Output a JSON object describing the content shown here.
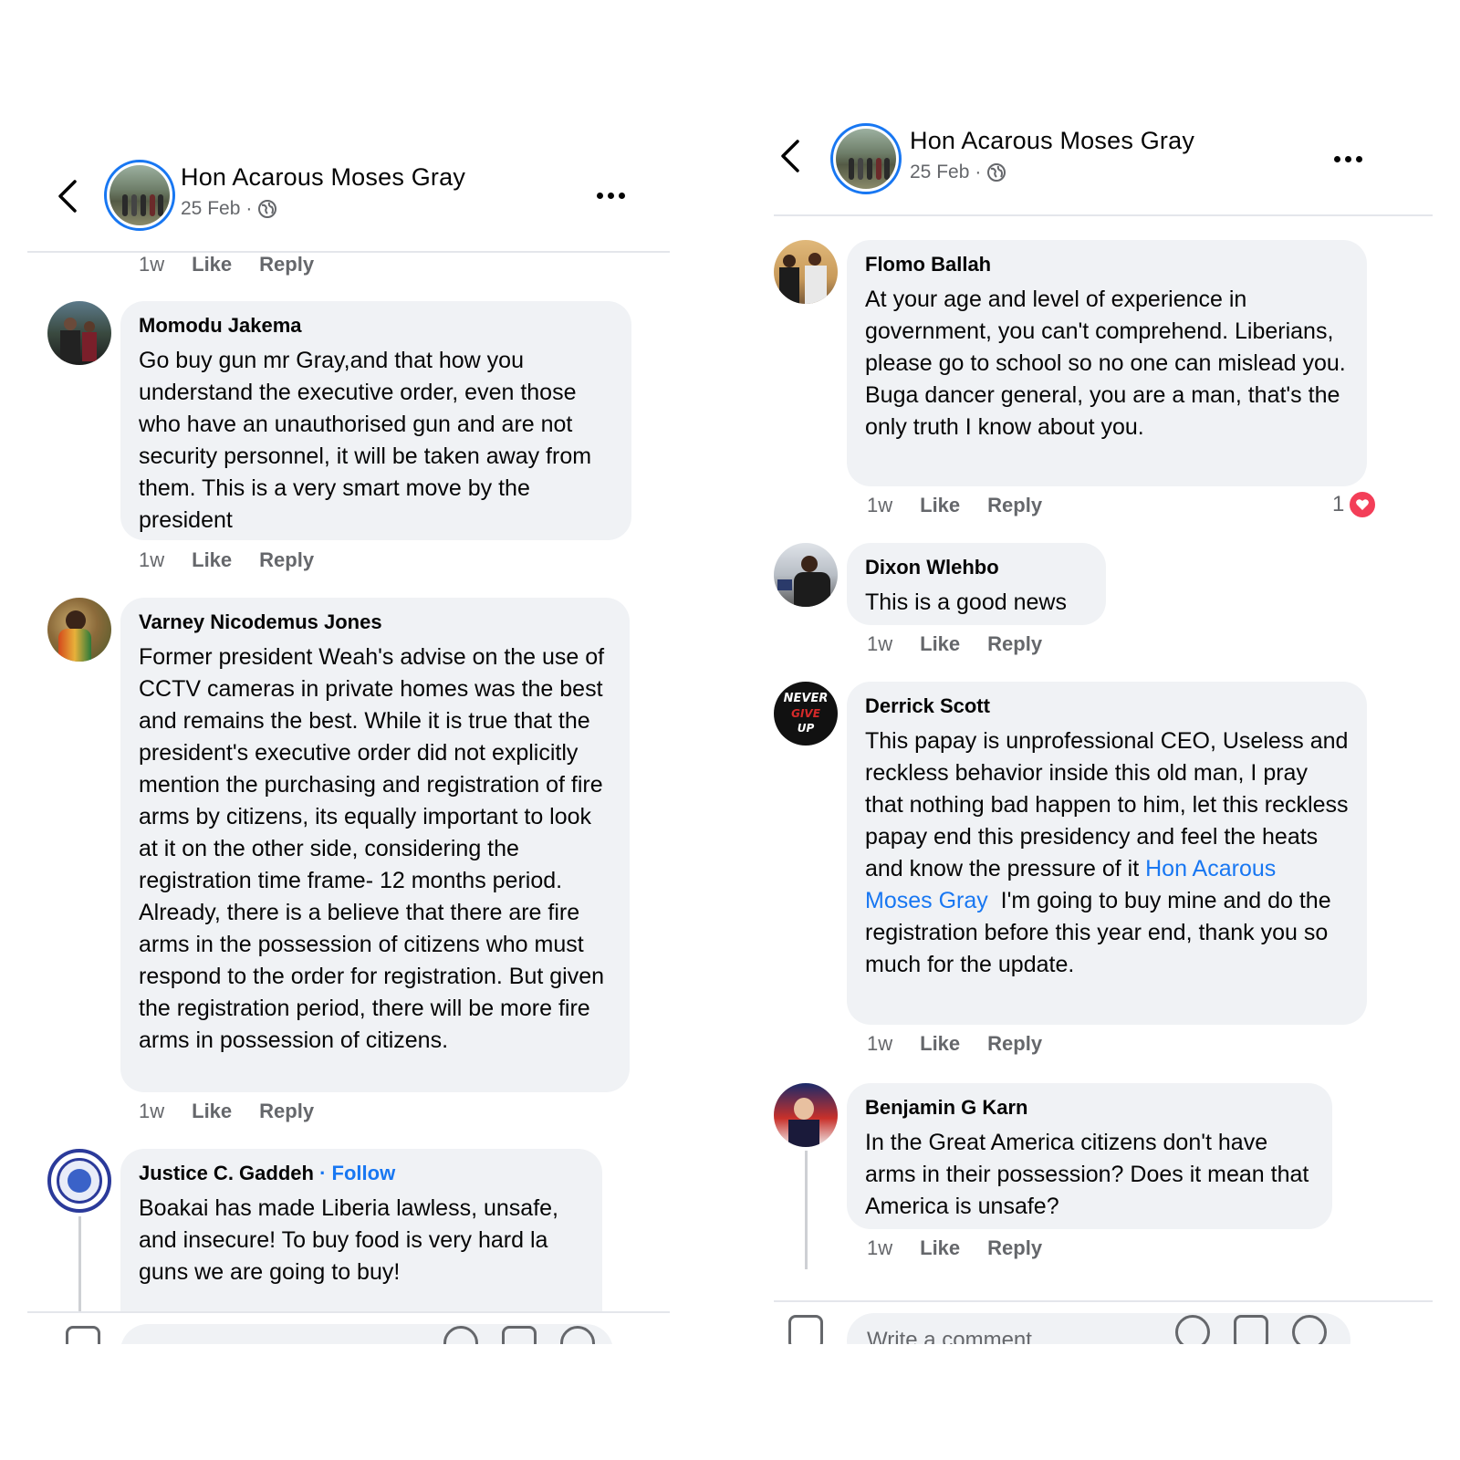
{
  "post": {
    "author": "Hon Acarous Moses Gray",
    "date": "25 Feb",
    "separator": "·"
  },
  "labels": {
    "like": "Like",
    "reply": "Reply",
    "follow": "Follow"
  },
  "left": {
    "top_actions": {
      "time": "1w"
    },
    "comments": [
      {
        "name": "Momodu Jakema",
        "time": "1w",
        "text": "Go buy gun mr Gray,and that how you understand the executive order, even those who have an unauthorised gun and are not security personnel, it will be taken away from them. This is a very smart move by the president"
      },
      {
        "name": "Varney Nicodemus Jones",
        "time": "1w",
        "text": "Former president Weah's advise on the use of CCTV cameras in private homes was the best and remains the best. While it is true that the president's executive order did not explicitly mention the purchasing and registration of fire arms by citizens, its equally important to look at it on the other side, considering the registration time frame- 12 months period. Already, there is a believe that there are fire arms in the possession of citizens who must respond to the order for registration. But given the registration period, there will be more fire arms in possession of citizens."
      },
      {
        "name": "Justice C. Gaddeh",
        "follow_sep": "·",
        "text": "Boakai has made Liberia lawless, unsafe, and insecure! To buy food is very hard la guns we are going to buy!"
      }
    ]
  },
  "right": {
    "comments": [
      {
        "name": "Flomo Ballah",
        "time": "1w",
        "reaction_count": "1",
        "text": "At your age and level of experience in government, you can't comprehend. Liberians, please go to school so no one can mislead you. Buga dancer general, you are a man, that's the only truth I know about you."
      },
      {
        "name": "Dixon Wlehbo",
        "time": "1w",
        "text": "This is a good news"
      },
      {
        "name": "Derrick Scott",
        "time": "1w",
        "text_before": "This papay is unprofessional CEO, Useless and reckless behavior inside this old man, I pray that nothing bad happen to him, let this reckless papay end this presidency and feel the heats and know the pressure of it ",
        "mention": "Hon Acarous Moses Gray",
        "text_after": "  I'm going to buy mine and do the registration before this year end, thank you so much for the update.",
        "avatar_text": [
          "NEVER",
          "GIVE",
          "UP"
        ]
      },
      {
        "name": "Benjamin G Karn",
        "time": "1w",
        "text": "In the Great America citizens don't have arms in their possession? Does it mean that America is unsafe?"
      }
    ],
    "composer_placeholder": "Write a comment…"
  },
  "icons": {
    "back": "chevron-left-icon",
    "more": "more-dots-icon",
    "globe": "globe-icon",
    "camera": "camera-icon",
    "sticker": "sticker-icon",
    "gif": "gif-icon",
    "emoji": "emoji-icon",
    "heart": "heart-reaction-icon"
  },
  "colors": {
    "accent": "#1877f2",
    "bubble": "#f0f2f5",
    "secondary_text": "#65676b",
    "heart": "#f33e58"
  }
}
